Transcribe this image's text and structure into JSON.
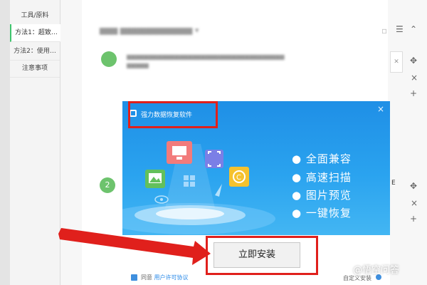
{
  "sidebar": {
    "items": [
      {
        "label": "工具/原料",
        "active": false
      },
      {
        "label": "方法1：超致…",
        "active": true
      },
      {
        "label": "方法2：使用…",
        "active": false
      },
      {
        "label": "注意事项",
        "active": false
      }
    ]
  },
  "main": {
    "step_badges": [
      "2"
    ],
    "edit_icons": [
      "move-icon",
      "close-icon",
      "add-icon"
    ]
  },
  "installer": {
    "title": "强力数据恢复软件",
    "close_glyph": "×",
    "features": [
      "● 全面兼容",
      "● 高速扫描",
      "● 图片预览",
      "● 一键恢复"
    ],
    "install_button": "立即安装",
    "agree_prefix": "同意",
    "agree_link": "用户许可协议",
    "custom_install": "自定义安装",
    "accent_color": "#1f8fe6",
    "highlight_color": "#e0201c"
  },
  "watermark": "@悟空问答"
}
